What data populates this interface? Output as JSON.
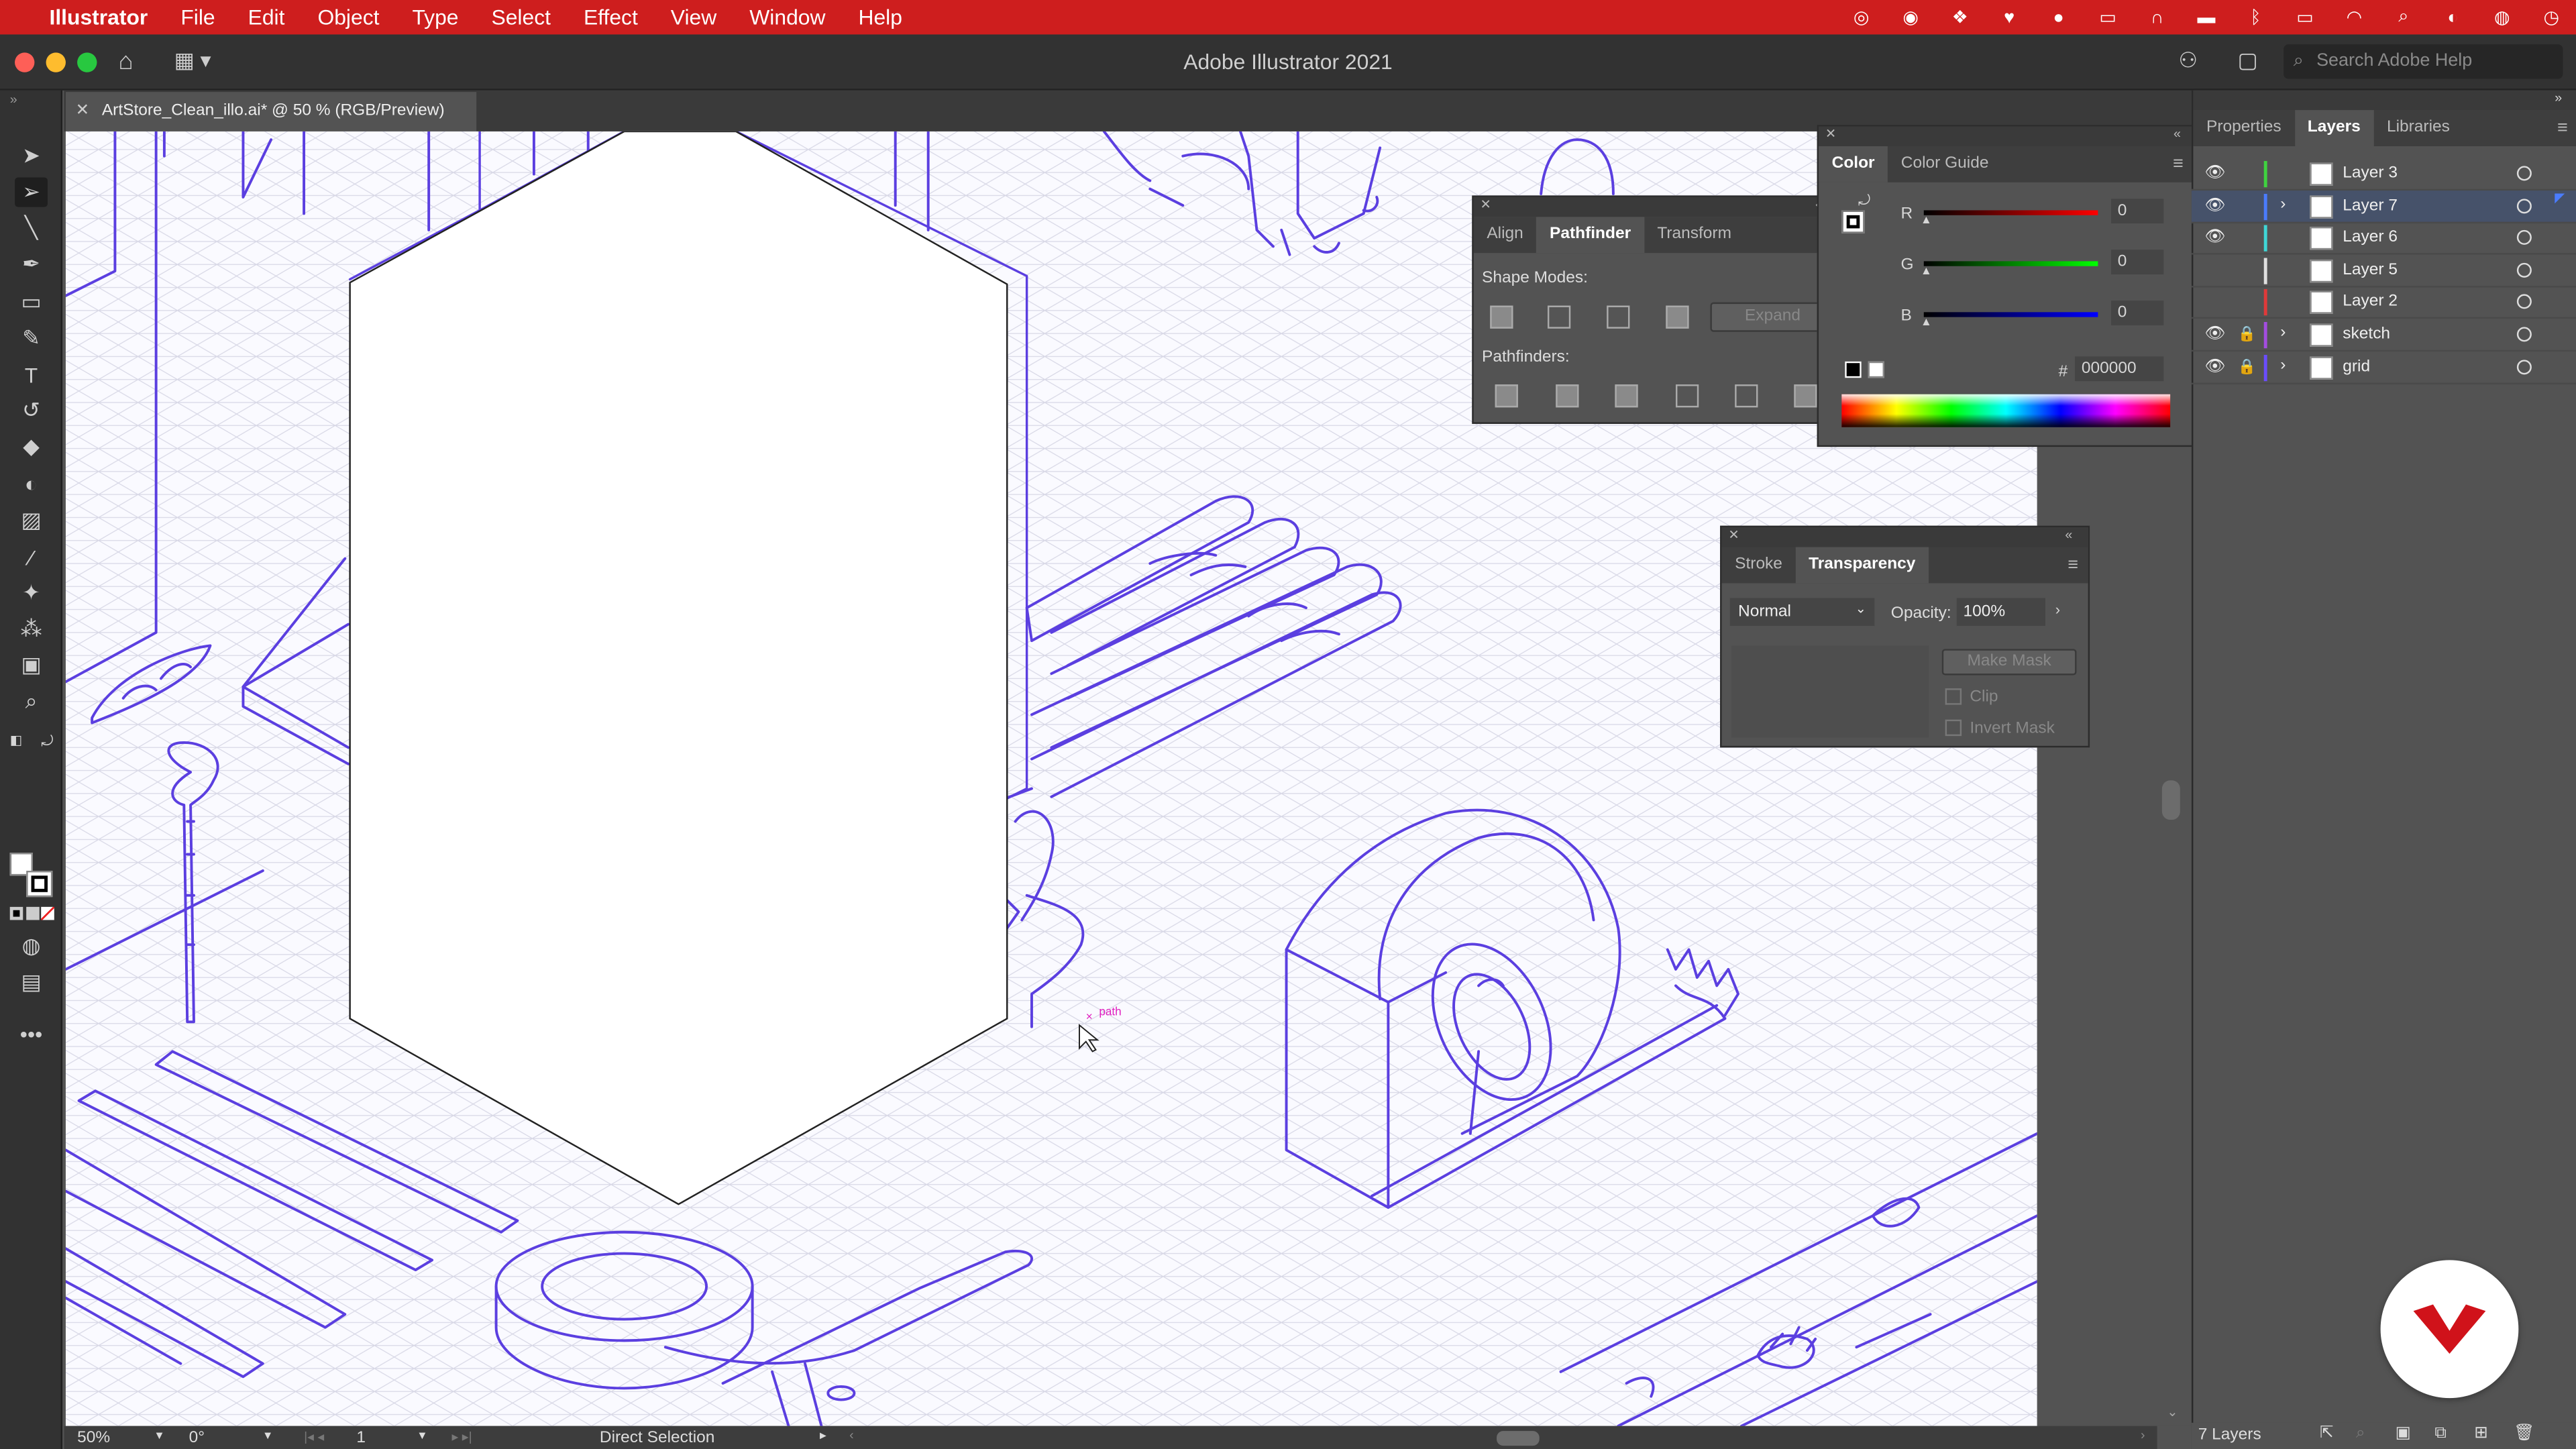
{
  "menubar": {
    "app": "Illustrator",
    "items": [
      "File",
      "Edit",
      "Object",
      "Type",
      "Select",
      "Effect",
      "View",
      "Window",
      "Help"
    ]
  },
  "window": {
    "title": "Adobe Illustrator 2021",
    "help_placeholder": "Search Adobe Help"
  },
  "document": {
    "tab": "ArtStore_Clean_illo.ai* @ 50 % (RGB/Preview)"
  },
  "cursor": {
    "hint": "path"
  },
  "pathfinder": {
    "tabs": [
      "Align",
      "Pathfinder",
      "Transform"
    ],
    "active": "Pathfinder",
    "shape_modes_label": "Shape Modes:",
    "expand_label": "Expand",
    "pathfinders_label": "Pathfinders:"
  },
  "color": {
    "tabs": [
      "Color",
      "Color Guide"
    ],
    "active": "Color",
    "r_label": "R",
    "g_label": "G",
    "b_label": "B",
    "r": "0",
    "g": "0",
    "b": "0",
    "hash": "#",
    "hex": "000000"
  },
  "transparency": {
    "tabs": [
      "Stroke",
      "Transparency"
    ],
    "active": "Transparency",
    "blend_mode": "Normal",
    "opacity_label": "Opacity:",
    "opacity": "100%",
    "make_mask": "Make Mask",
    "clip": "Clip",
    "invert_mask": "Invert Mask"
  },
  "dock": {
    "tabs": [
      "Properties",
      "Layers",
      "Libraries"
    ],
    "active": "Layers"
  },
  "layers": [
    {
      "name": "Layer 3",
      "color": "#3fd23f",
      "visible": true,
      "locked": false,
      "expandable": false,
      "selected": false
    },
    {
      "name": "Layer 7",
      "color": "#4a7cff",
      "visible": true,
      "locked": false,
      "expandable": true,
      "selected": true
    },
    {
      "name": "Layer 6",
      "color": "#3fd6d6",
      "visible": true,
      "locked": false,
      "expandable": false,
      "selected": false
    },
    {
      "name": "Layer 5",
      "color": "#e0e0e0",
      "visible": false,
      "locked": false,
      "expandable": false,
      "selected": false
    },
    {
      "name": "Layer 2",
      "color": "#e03a3a",
      "visible": false,
      "locked": false,
      "expandable": false,
      "selected": false
    },
    {
      "name": "sketch",
      "color": "#a34de0",
      "visible": true,
      "locked": true,
      "expandable": true,
      "selected": false
    },
    {
      "name": "grid",
      "color": "#6a4dff",
      "visible": true,
      "locked": true,
      "expandable": true,
      "selected": false
    }
  ],
  "layers_count": "7 Layers",
  "status": {
    "zoom": "50%",
    "rotation": "0°",
    "artboard": "1",
    "tool": "Direct Selection"
  },
  "colors": {
    "menubar": "#ce1e1e",
    "sketch": "#5b3fe0",
    "canvas_bg": "#fafaff"
  }
}
